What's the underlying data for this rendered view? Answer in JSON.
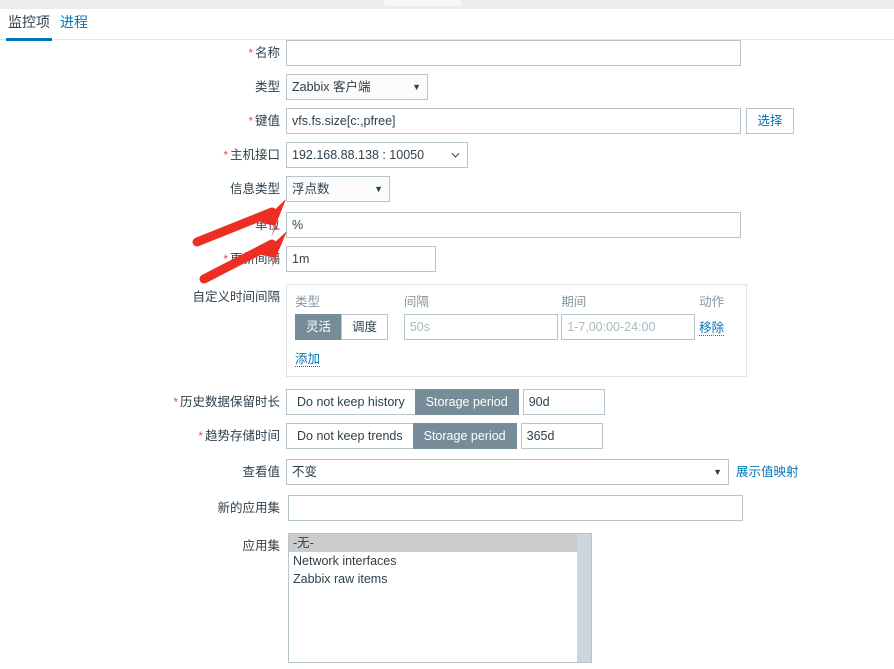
{
  "tabs": [
    {
      "label": "监控项",
      "active": true
    },
    {
      "label": "进程",
      "active": false
    }
  ],
  "form": {
    "name": {
      "label": "名称",
      "required": true,
      "value": "",
      "placeholder": ""
    },
    "type": {
      "label": "类型",
      "required": false,
      "value": "Zabbix 客户端"
    },
    "key": {
      "label": "键值",
      "required": true,
      "value": "vfs.fs.size[c:,pfree]",
      "select_button": "选择"
    },
    "host_interface": {
      "label": "主机接口",
      "required": true,
      "value": "192.168.88.138 : 10050"
    },
    "value_type": {
      "label": "信息类型",
      "required": false,
      "value": "浮点数"
    },
    "units": {
      "label": "单位",
      "required": false,
      "value": "%",
      "focused": true
    },
    "update_interval": {
      "label": "更新间隔",
      "required": true,
      "value": "1m"
    },
    "custom_intervals": {
      "label": "自定义时间间隔",
      "columns": [
        "类型",
        "间隔",
        "期间",
        "动作"
      ],
      "rows": [
        {
          "type_options": [
            "灵活",
            "调度"
          ],
          "type_selected": "灵活",
          "interval_value": "",
          "interval_placeholder": "50s",
          "period_value": "",
          "period_placeholder": "1-7,00:00-24:00",
          "action": "移除"
        }
      ],
      "add_link": "添加"
    },
    "history": {
      "label": "历史数据保留时长",
      "required": true,
      "options": [
        "Do not keep history",
        "Storage period"
      ],
      "selected": "Storage period",
      "value": "90d"
    },
    "trends": {
      "label": "趋势存储时间",
      "required": true,
      "options": [
        "Do not keep trends",
        "Storage period"
      ],
      "selected": "Storage period",
      "value": "365d"
    },
    "show_value": {
      "label": "查看值",
      "required": false,
      "value": "不变",
      "mapping_link": "展示值映射"
    },
    "new_application": {
      "label": "新的应用集",
      "required": false,
      "value": "",
      "placeholder": "",
      "focused": true
    },
    "applications": {
      "label": "应用集",
      "options": [
        {
          "text": "-无-",
          "selected": true
        },
        {
          "text": "Network interfaces",
          "selected": false
        },
        {
          "text": "Zabbix raw items",
          "selected": false
        }
      ]
    }
  },
  "annotations": {
    "arrow_color": "#ee2d24",
    "arrows": [
      {
        "name": "arrow-to-value-type",
        "target": "信息类型"
      },
      {
        "name": "arrow-to-units",
        "target": "单位"
      }
    ]
  },
  "colors": {
    "accent_link": "#0275b8",
    "toggle_active_bg": "#768d99",
    "required_star": "#d45a52",
    "focus_blue": "#1f6fb2",
    "focus_green": "#c6e0c0",
    "text": "#30404b"
  }
}
